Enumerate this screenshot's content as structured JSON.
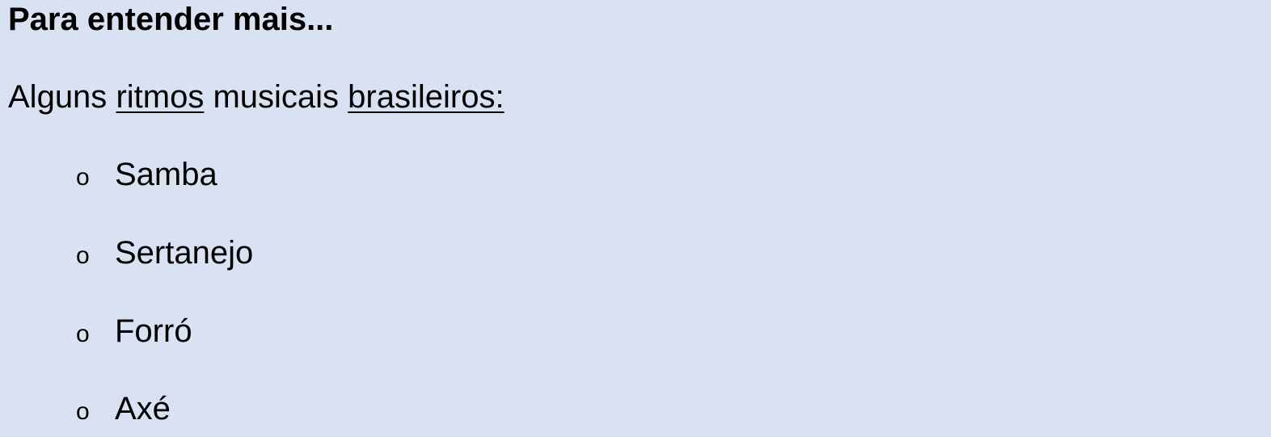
{
  "heading": "Para entender mais...",
  "intro": {
    "w1": "Alguns",
    "w2": "ritmos",
    "w3": "musicais",
    "w4": "brasileiros:"
  },
  "bullet_glyph": "o",
  "items": [
    "Samba",
    "Sertanejo",
    "Forró",
    "Axé"
  ]
}
